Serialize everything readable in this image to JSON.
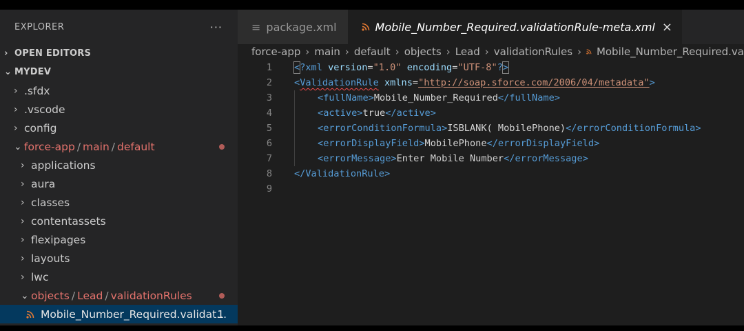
{
  "sidebar": {
    "title": "EXPLORER",
    "more": "···",
    "sections": {
      "open_editors": "OPEN EDITORS",
      "workspace": "MYDEV"
    },
    "items": [
      {
        "label": ".sfdx"
      },
      {
        "label": ".vscode"
      },
      {
        "label": "config"
      },
      {
        "label": "force-app/main/default",
        "parts": [
          "force-app",
          "main",
          "default"
        ]
      },
      {
        "label": "applications"
      },
      {
        "label": "aura"
      },
      {
        "label": "classes"
      },
      {
        "label": "contentassets"
      },
      {
        "label": "flexipages"
      },
      {
        "label": "layouts"
      },
      {
        "label": "lwc"
      },
      {
        "label": "objects/Lead/validationRules",
        "parts": [
          "objects",
          "Lead",
          "validationRules"
        ]
      }
    ],
    "selected_file": {
      "label": "Mobile_Number_Required.validat...",
      "badge": "1"
    }
  },
  "tabs": [
    {
      "label": "package.xml",
      "icon": "lines-icon"
    },
    {
      "label": "Mobile_Number_Required.validationRule-meta.xml",
      "icon": "rss-icon",
      "close": "×"
    }
  ],
  "breadcrumb": [
    "force-app",
    "main",
    "default",
    "objects",
    "Lead",
    "validationRules",
    "Mobile_Number_Required.va"
  ],
  "code": {
    "line_numbers": [
      "1",
      "2",
      "3",
      "4",
      "5",
      "6",
      "7",
      "8",
      "9"
    ],
    "l1": {
      "open": "<",
      "q": "?",
      "name": "xml",
      "a1": "version",
      "eq": "=",
      "v1": "\"1.0\"",
      "a2": "encoding",
      "v2": "\"UTF-8\"",
      "q2": "?",
      "close": ">"
    },
    "l2": {
      "open": "<",
      "name": "ValidationRule",
      "attr": "xmlns",
      "eq": "=",
      "val": "\"http://soap.sforce.com/2006/04/metadata\"",
      "close": ">"
    },
    "l3": {
      "tag": "fullName",
      "text": "Mobile_Number_Required"
    },
    "l4": {
      "tag": "active",
      "text": "true"
    },
    "l5": {
      "tag": "errorConditionFormula",
      "text": "ISBLANK( MobilePhone)"
    },
    "l6": {
      "tag": "errorDisplayField",
      "text": "MobilePhone"
    },
    "l7": {
      "tag": "errorMessage",
      "text": "Enter Mobile Number"
    },
    "l8": {
      "tag": "ValidationRule"
    }
  },
  "colors": {
    "accent_selected": "#04395e",
    "modified": "#e5736d",
    "tag": "#569cd6",
    "attr": "#9cdcfe",
    "string": "#ce9178"
  }
}
